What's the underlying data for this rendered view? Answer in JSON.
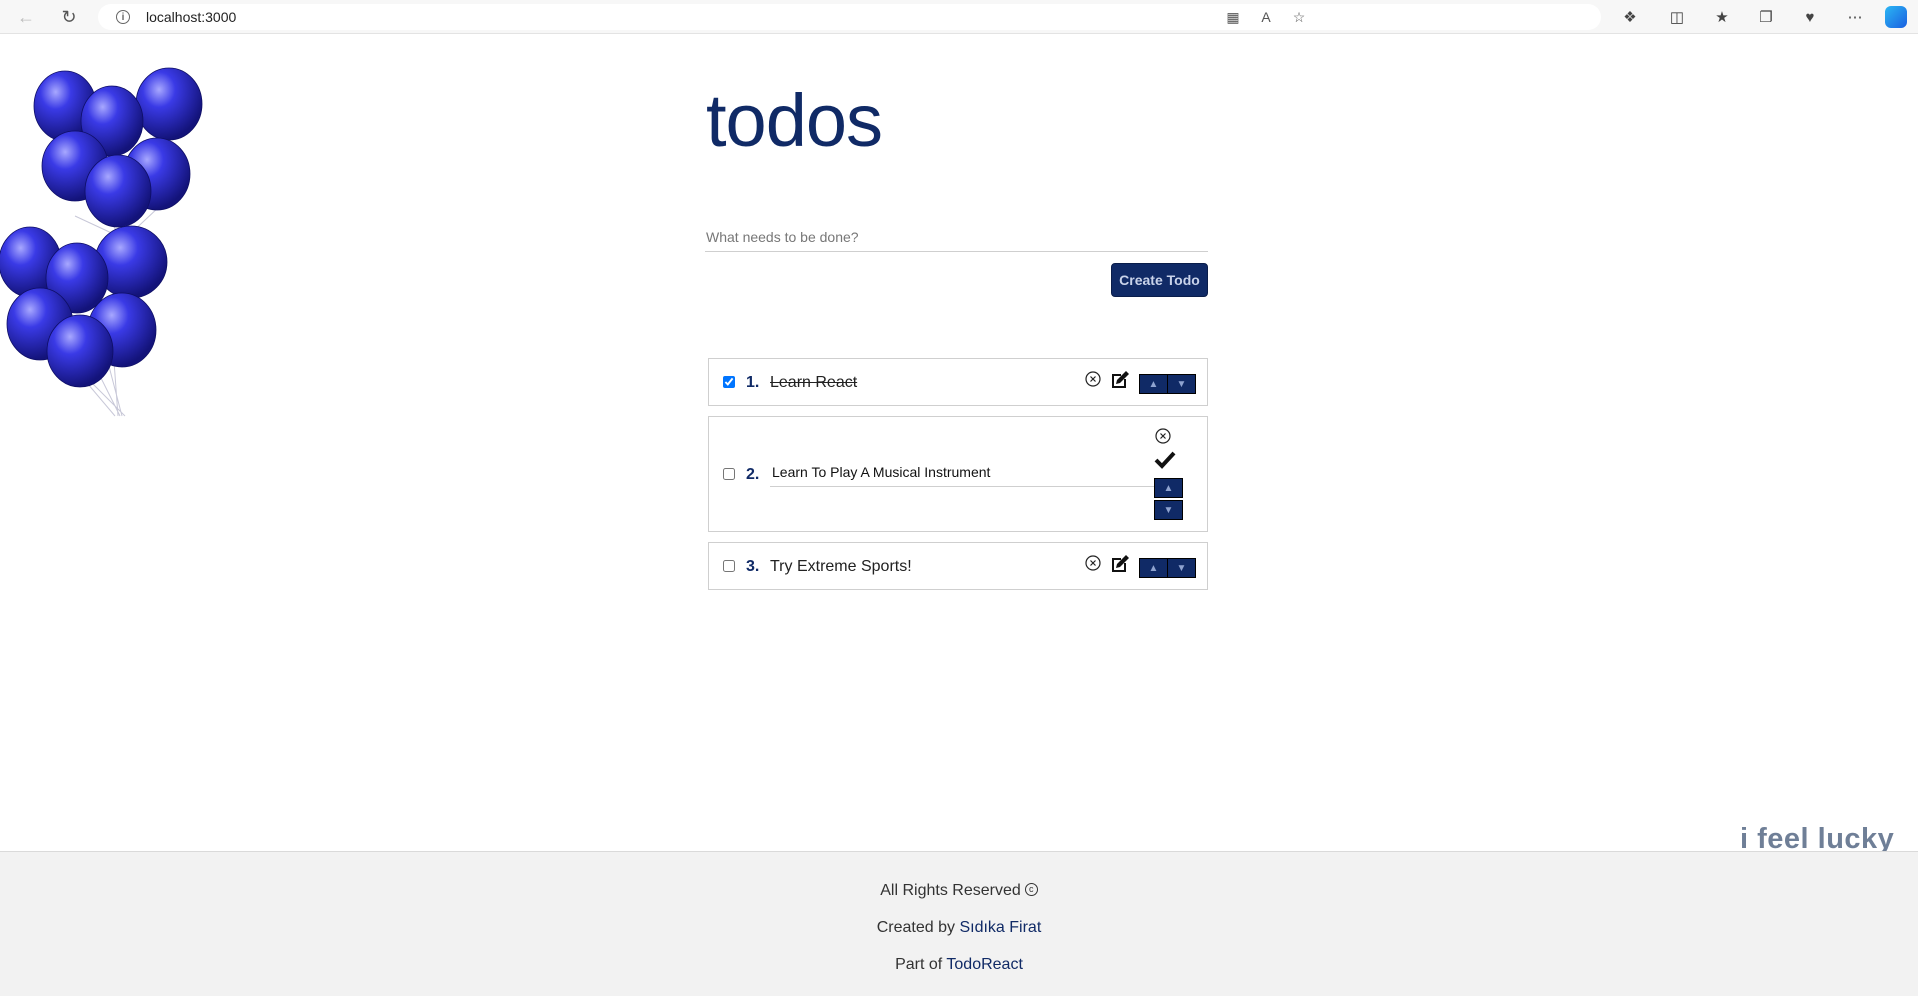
{
  "browser": {
    "url": "localhost:3000"
  },
  "app": {
    "title": "todos",
    "new_todo_placeholder": "What needs to be done?",
    "create_button": "Create Todo"
  },
  "todos": [
    {
      "number": "1.",
      "text": "Learn React",
      "completed": true,
      "editing": false
    },
    {
      "number": "2.",
      "text": "Learn To Play A Musical Instrument",
      "completed": false,
      "editing": true
    },
    {
      "number": "3.",
      "text": "Try Extreme Sports!",
      "completed": false,
      "editing": false
    }
  ],
  "lucky_text": "i feel lucky",
  "footer": {
    "rights": "All Rights Reserved",
    "created_by_prefix": "Created by",
    "author": "Sıdıka Firat",
    "part_of_prefix": "Part of",
    "project": "TodoReact"
  },
  "colors": {
    "brand_navy": "#102a66",
    "balloon_blue": "#2a2ad6"
  },
  "icons": {
    "delete": "circled-x-icon",
    "edit": "edit-pencil-icon",
    "save": "checkmark-icon",
    "move_up": "up-arrow-icon",
    "move_down": "down-arrow-icon"
  }
}
